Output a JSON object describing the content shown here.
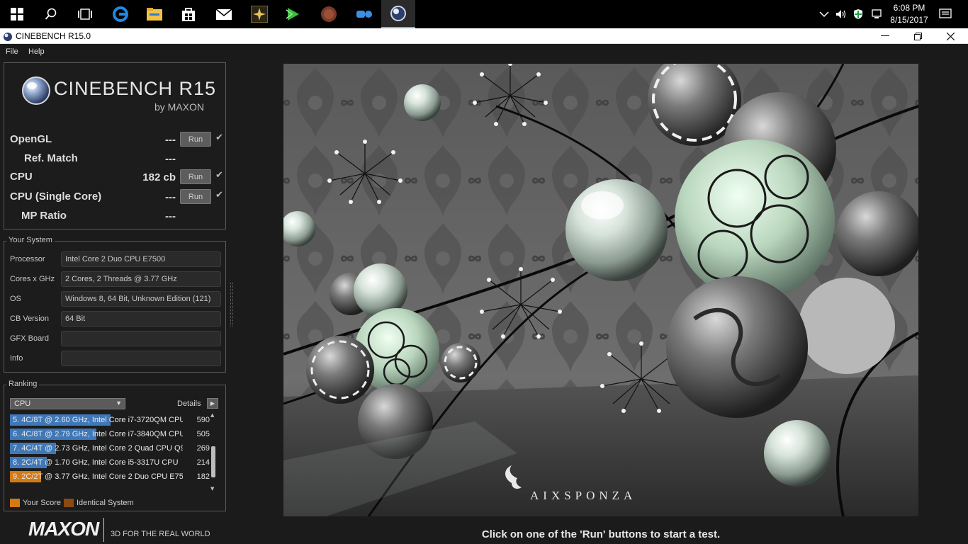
{
  "taskbar": {
    "icons": [
      "windows-start-icon",
      "search-icon",
      "task-view-icon",
      "edge-browser-icon",
      "file-explorer-icon",
      "store-icon",
      "mail-icon",
      "app-icon",
      "media-player-icon",
      "app-icon-2",
      "app-icon-3",
      "cinebench-icon"
    ],
    "clock_time": "6:08 PM",
    "clock_date": "8/15/2017"
  },
  "window": {
    "title": "CINEBENCH R15.0"
  },
  "menu": {
    "items": [
      "File",
      "Help"
    ]
  },
  "logo": {
    "name": "CINEBENCH R15",
    "sub": "by MAXON"
  },
  "benchmarks": {
    "opengl": {
      "label": "OpenGL",
      "value": "---",
      "run": "Run"
    },
    "ref_match": {
      "label": "Ref. Match",
      "value": "---"
    },
    "cpu": {
      "label": "CPU",
      "value": "182 cb",
      "run": "Run"
    },
    "cpu_single": {
      "label": "CPU (Single Core)",
      "value": "---",
      "run": "Run"
    },
    "mp_ratio": {
      "label": "MP Ratio",
      "value": "---"
    }
  },
  "your_system": {
    "heading": "Your System",
    "rows": [
      {
        "label": "Processor",
        "value": "Intel Core 2 Duo CPU E7500"
      },
      {
        "label": "Cores x GHz",
        "value": "2 Cores, 2 Threads @ 3.77 GHz"
      },
      {
        "label": "OS",
        "value": "Windows 8, 64 Bit, Unknown Edition (121)"
      },
      {
        "label": "CB Version",
        "value": "64 Bit"
      },
      {
        "label": "GFX Board",
        "value": ""
      },
      {
        "label": "Info",
        "value": ""
      }
    ]
  },
  "ranking": {
    "heading": "Ranking",
    "selected": "CPU",
    "details_label": "Details",
    "max_score": 590,
    "rows": [
      {
        "text": "5. 4C/8T @ 2.60 GHz, Intel Core i7-3720QM CPU",
        "score": 590,
        "mine": false
      },
      {
        "text": "6. 4C/8T @ 2.79 GHz,  Intel Core i7-3840QM CPU",
        "score": 505,
        "mine": false
      },
      {
        "text": "7. 4C/4T @ 2.73 GHz, Intel Core 2 Quad CPU Q9",
        "score": 269,
        "mine": false
      },
      {
        "text": "8. 2C/4T @ 1.70 GHz,  Intel Core i5-3317U CPU",
        "score": 214,
        "mine": false
      },
      {
        "text": "9. 2C/2T @ 3.77 GHz, Intel Core 2 Duo CPU E75",
        "score": 182,
        "mine": true
      }
    ],
    "legend_your_score": "Your Score",
    "legend_identical": "Identical System",
    "colors": {
      "bar": "#3f78b8",
      "your_score": "#d47a12",
      "identical": "#8a4a12"
    }
  },
  "footer": {
    "brand": "MAXON",
    "tagline": "3D FOR THE REAL WORLD"
  },
  "render": {
    "watermark": "AIXSPONZA",
    "status": "Click on one of the 'Run' buttons to start a test."
  }
}
